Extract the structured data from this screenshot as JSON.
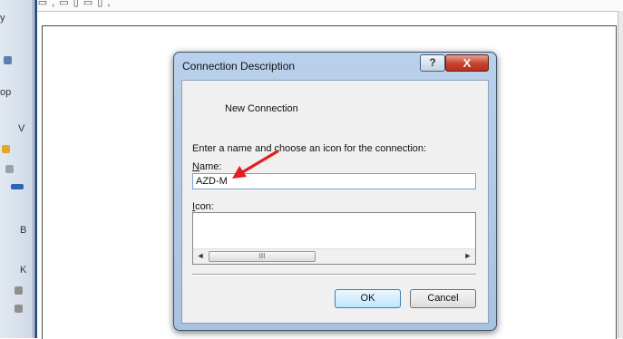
{
  "background": {
    "top_glyphs": "□ ▭ , ▭ ▯ ▭ ▯ ,",
    "left_panel_text": [
      "y",
      "op",
      "V",
      "B",
      "K"
    ]
  },
  "dialog": {
    "title": "Connection Description",
    "help_label": "?",
    "close_label": "X",
    "heading": "New Connection",
    "instructions": "Enter a name and choose an icon for the connection:",
    "name_label_accel": "N",
    "name_label_rest": "ame:",
    "name_value": "AZD-M",
    "icon_label_accel": "I",
    "icon_label_rest": "con:",
    "scroll_left": "◄",
    "scroll_right": "►",
    "scroll_thumb_grip": "III",
    "ok_label": "OK",
    "cancel_label": "Cancel"
  },
  "colors": {
    "annotation_arrow": "#e31e1e",
    "title_bar": "#b9d1ea",
    "close_button": "#c7412c"
  }
}
